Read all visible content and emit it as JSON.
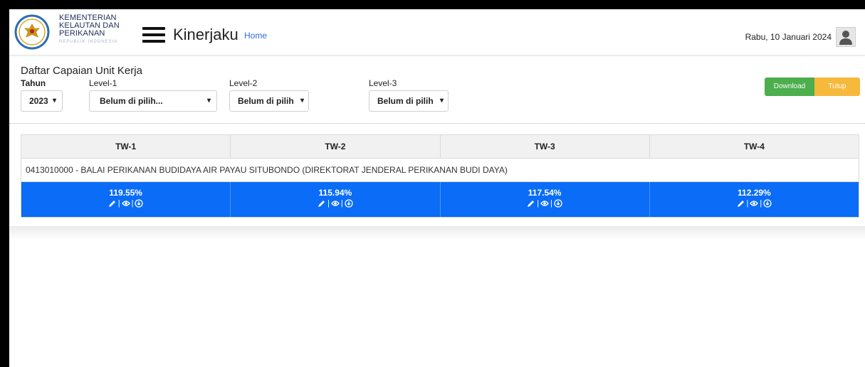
{
  "header": {
    "logo_line1": "KEMENTERIAN",
    "logo_line2": "KELAUTAN DAN",
    "logo_line3": "PERIKANAN",
    "logo_sub": "REPUBLIK INDONESIA",
    "app_title": "Kinerjaku",
    "home_link": "Home",
    "date": "Rabu, 10 Januari 2024",
    "menu_icon": "hamburger-icon",
    "avatar_icon": "user-icon"
  },
  "filters": {
    "title": "Daftar Capaian Unit Kerja",
    "tahun_label": "Tahun",
    "tahun_value": "2023",
    "level1_label": "Level-1",
    "level1_value": "Belum di pilih...",
    "level2_label": "Level-2",
    "level2_value": "Belum di pilih",
    "level3_label": "Level-3",
    "level3_value": "Belum di pilih",
    "caret": "▾"
  },
  "actions": {
    "download_label": "Download",
    "tutup_label": "Tutup",
    "download_color": "#4cae4c",
    "tutup_color": "#f6b93b"
  },
  "table": {
    "headers": [
      "TW-1",
      "TW-2",
      "TW-3",
      "TW-4"
    ],
    "unit": "0413010000 - BALAI PERIKANAN BUDIDAYA AIR PAYAU SITUBONDO (DIREKTORAT JENDERAL PERIKANAN BUDI DAYA)",
    "values": [
      "119.55%",
      "115.94%",
      "117.54%",
      "112.29%"
    ],
    "separator": "|",
    "row_color": "#0a6cf7",
    "icons": [
      "pencil-icon",
      "eye-icon",
      "download-icon"
    ]
  }
}
